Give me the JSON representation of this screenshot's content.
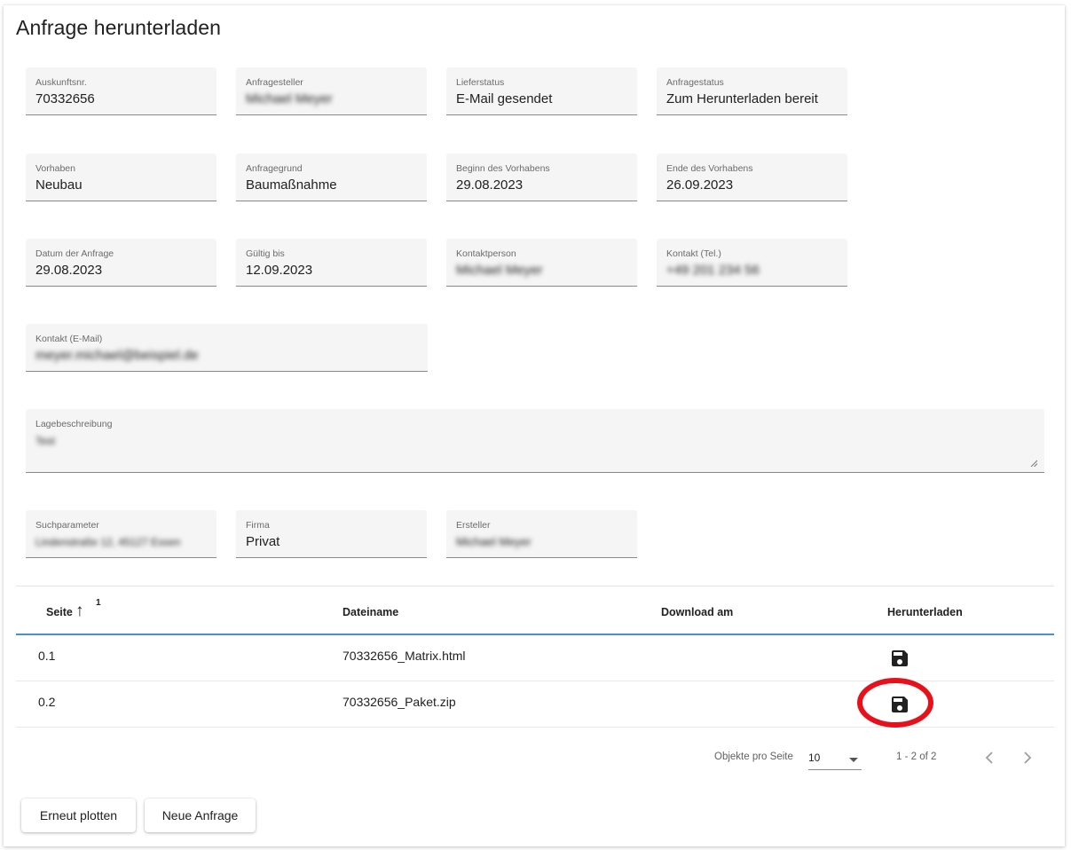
{
  "page": {
    "title": "Anfrage herunterladen"
  },
  "fields": {
    "auskunftsnr": {
      "label": "Auskunftsnr.",
      "value": "70332656"
    },
    "anfragesteller": {
      "label": "Anfragesteller",
      "value": "Michael Meyer"
    },
    "lieferstatus": {
      "label": "Lieferstatus",
      "value": "E-Mail gesendet"
    },
    "anfragestatus": {
      "label": "Anfragestatus",
      "value": "Zum Herunterladen bereit"
    },
    "vorhaben": {
      "label": "Vorhaben",
      "value": "Neubau"
    },
    "anfragegrund": {
      "label": "Anfragegrund",
      "value": "Baumaßnahme"
    },
    "beginn": {
      "label": "Beginn des Vorhabens",
      "value": "29.08.2023"
    },
    "ende": {
      "label": "Ende des Vorhabens",
      "value": "26.09.2023"
    },
    "datum": {
      "label": "Datum der Anfrage",
      "value": "29.08.2023"
    },
    "gueltig": {
      "label": "Gültig bis",
      "value": "12.09.2023"
    },
    "kontaktperson": {
      "label": "Kontaktperson",
      "value": "Michael Meyer"
    },
    "kontakt_tel": {
      "label": "Kontakt (Tel.)",
      "value": "+49 201 234 56"
    },
    "kontakt_email": {
      "label": "Kontakt (E-Mail)",
      "value": "meyer.michael@beispiel.de"
    },
    "lagebeschreibung": {
      "label": "Lagebeschreibung",
      "value": "Test"
    },
    "suchparameter": {
      "label": "Suchparameter",
      "value": "Lindenstraße 12, 45127 Essen"
    },
    "firma": {
      "label": "Firma",
      "value": "Privat"
    },
    "ersteller": {
      "label": "Ersteller",
      "value": "Michael Meyer"
    }
  },
  "table": {
    "headers": {
      "seite": "Seite",
      "sort_index": "1",
      "dateiname": "Dateiname",
      "download_am": "Download am",
      "herunterladen": "Herunterladen"
    },
    "rows": [
      {
        "seite": "0.1",
        "dateiname": "70332656_Matrix.html",
        "download_am": ""
      },
      {
        "seite": "0.2",
        "dateiname": "70332656_Paket.zip",
        "download_am": ""
      }
    ]
  },
  "paginator": {
    "label": "Objekte pro Seite",
    "page_size": "10",
    "range": "1 - 2 of 2"
  },
  "buttons": {
    "replot": "Erneut plotten",
    "new_request": "Neue Anfrage"
  },
  "colors": {
    "highlight": "#e8101a",
    "header_underline": "#4a90cf",
    "field_bg": "#f5f5f5"
  },
  "icons": {
    "sort": "arrow-up-icon",
    "download": "floppy-disk-icon",
    "prev": "chevron-left-icon",
    "next": "chevron-right-icon",
    "dropdown": "caret-down-icon"
  }
}
